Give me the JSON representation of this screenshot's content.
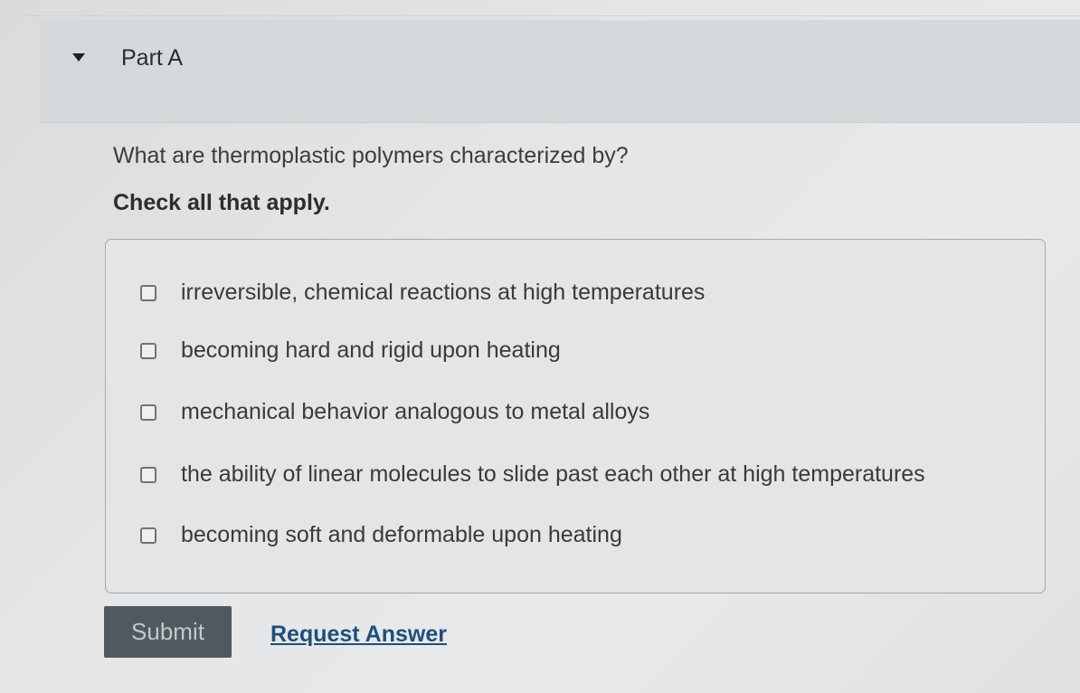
{
  "part": {
    "title": "Part A"
  },
  "question": {
    "text": "What are thermoplastic polymers characterized by?",
    "instruction": "Check all that apply."
  },
  "options": [
    {
      "label": "irreversible, chemical reactions at high temperatures",
      "checked": false
    },
    {
      "label": "becoming hard and rigid upon heating",
      "checked": false
    },
    {
      "label": "mechanical behavior analogous to metal alloys",
      "checked": false
    },
    {
      "label": "the ability of linear molecules to slide past each other at high temperatures",
      "checked": false
    },
    {
      "label": "becoming soft and deformable upon heating",
      "checked": false
    }
  ],
  "actions": {
    "submit_label": "Submit",
    "request_answer_label": "Request Answer"
  },
  "icons": {
    "toggle": "caret-down-icon",
    "checkbox": "checkbox-unchecked-icon"
  }
}
